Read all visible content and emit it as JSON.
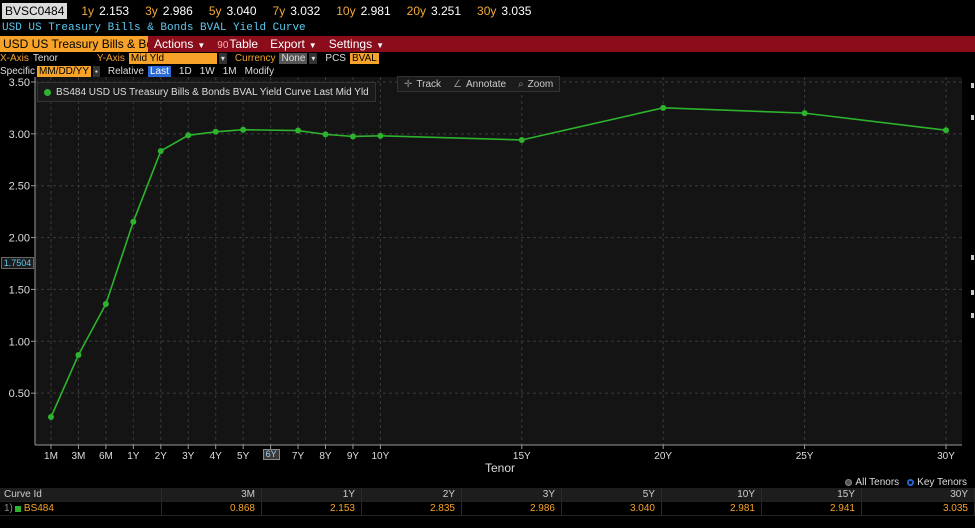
{
  "ticker": {
    "security": "BVSC0484",
    "items": [
      {
        "k": "1y",
        "v": "2.153"
      },
      {
        "k": "3y",
        "v": "2.986"
      },
      {
        "k": "5y",
        "v": "3.040"
      },
      {
        "k": "7y",
        "v": "3.032"
      },
      {
        "k": "10y",
        "v": "2.981"
      },
      {
        "k": "20y",
        "v": "3.251"
      },
      {
        "k": "30y",
        "v": "3.035"
      }
    ]
  },
  "title_line": "USD US Treasury Bills & Bonds BVAL Yield Curve",
  "menubar": {
    "curve_name": "USD US Treasury Bills & Bc",
    "actions": "Actions",
    "table_num": "90",
    "table": "Table",
    "export": "Export",
    "settings": "Settings"
  },
  "axisbar": {
    "xaxis_label": "X-Axis",
    "xaxis_value": "Tenor",
    "yaxis_label": "Y-Axis",
    "yaxis_value": "Mid Yld",
    "currency_label": "Currency",
    "currency_value": "None",
    "pcs_label": "PCS",
    "pcs_value": "BVAL"
  },
  "rangebar": {
    "specific_label": "Specific",
    "date_value": "MM/DD/YY",
    "relative_label": "Relative",
    "options": [
      "Last",
      "1D",
      "1W",
      "1M",
      "Modify"
    ]
  },
  "legend": {
    "series_label": "BS484 USD US Treasury Bills & Bonds BVAL Yield Curve Last Mid Yld"
  },
  "tools": {
    "track": "Track",
    "annotate": "Annotate",
    "zoom": "Zoom"
  },
  "crosshair_value": "1.7504",
  "current_tick": "6Y",
  "tenor_toggle": {
    "all": "All Tenors",
    "key": "Key Tenors"
  },
  "table": {
    "headers": [
      "Curve Id",
      "3M",
      "1Y",
      "2Y",
      "3Y",
      "5Y",
      "10Y",
      "15Y",
      "30Y"
    ],
    "row_number": "1)",
    "row": [
      "BS484",
      "0.868",
      "2.153",
      "2.835",
      "2.986",
      "3.040",
      "2.981",
      "2.941",
      "3.035"
    ]
  },
  "colors": {
    "series": "#2db32d",
    "accent": "#f7a32a",
    "menubar": "#8b0d1b",
    "title": "#5ec8f0"
  },
  "chart_data": {
    "type": "line",
    "title": "",
    "xlabel": "Tenor",
    "ylabel": "",
    "ylim": [
      0,
      3.5
    ],
    "yticks": [
      0.5,
      1.0,
      1.5,
      2.0,
      2.5,
      3.0,
      3.5
    ],
    "ytick_labels": [
      "0.50",
      "1.00",
      "1.50",
      "2.00",
      "2.50",
      "3.00",
      "3.50"
    ],
    "x_ticks": [
      {
        "label": "1M",
        "years": 0.0833
      },
      {
        "label": "3M",
        "years": 0.25
      },
      {
        "label": "6M",
        "years": 0.5
      },
      {
        "label": "1Y",
        "years": 1
      },
      {
        "label": "2Y",
        "years": 2
      },
      {
        "label": "3Y",
        "years": 3
      },
      {
        "label": "4Y",
        "years": 4
      },
      {
        "label": "5Y",
        "years": 5
      },
      {
        "label": "6Y",
        "years": 6
      },
      {
        "label": "7Y",
        "years": 7
      },
      {
        "label": "8Y",
        "years": 8
      },
      {
        "label": "9Y",
        "years": 9
      },
      {
        "label": "10Y",
        "years": 10
      },
      {
        "label": "15Y",
        "years": 15
      },
      {
        "label": "20Y",
        "years": 20
      },
      {
        "label": "25Y",
        "years": 25
      },
      {
        "label": "30Y",
        "years": 30
      }
    ],
    "grid": true,
    "series": [
      {
        "name": "BS484 USD US Treasury Bills & Bonds BVAL Yield Curve Last Mid Yld",
        "color": "#2db32d",
        "points": [
          {
            "tenor": "1M",
            "y": 0.27
          },
          {
            "tenor": "3M",
            "y": 0.868
          },
          {
            "tenor": "6M",
            "y": 1.36
          },
          {
            "tenor": "1Y",
            "y": 2.153
          },
          {
            "tenor": "2Y",
            "y": 2.835
          },
          {
            "tenor": "3Y",
            "y": 2.986
          },
          {
            "tenor": "4Y",
            "y": 3.02
          },
          {
            "tenor": "5Y",
            "y": 3.04
          },
          {
            "tenor": "7Y",
            "y": 3.032
          },
          {
            "tenor": "8Y",
            "y": 2.995
          },
          {
            "tenor": "9Y",
            "y": 2.975
          },
          {
            "tenor": "10Y",
            "y": 2.981
          },
          {
            "tenor": "15Y",
            "y": 2.941
          },
          {
            "tenor": "20Y",
            "y": 3.251
          },
          {
            "tenor": "25Y",
            "y": 3.2
          },
          {
            "tenor": "30Y",
            "y": 3.035
          }
        ]
      }
    ]
  }
}
